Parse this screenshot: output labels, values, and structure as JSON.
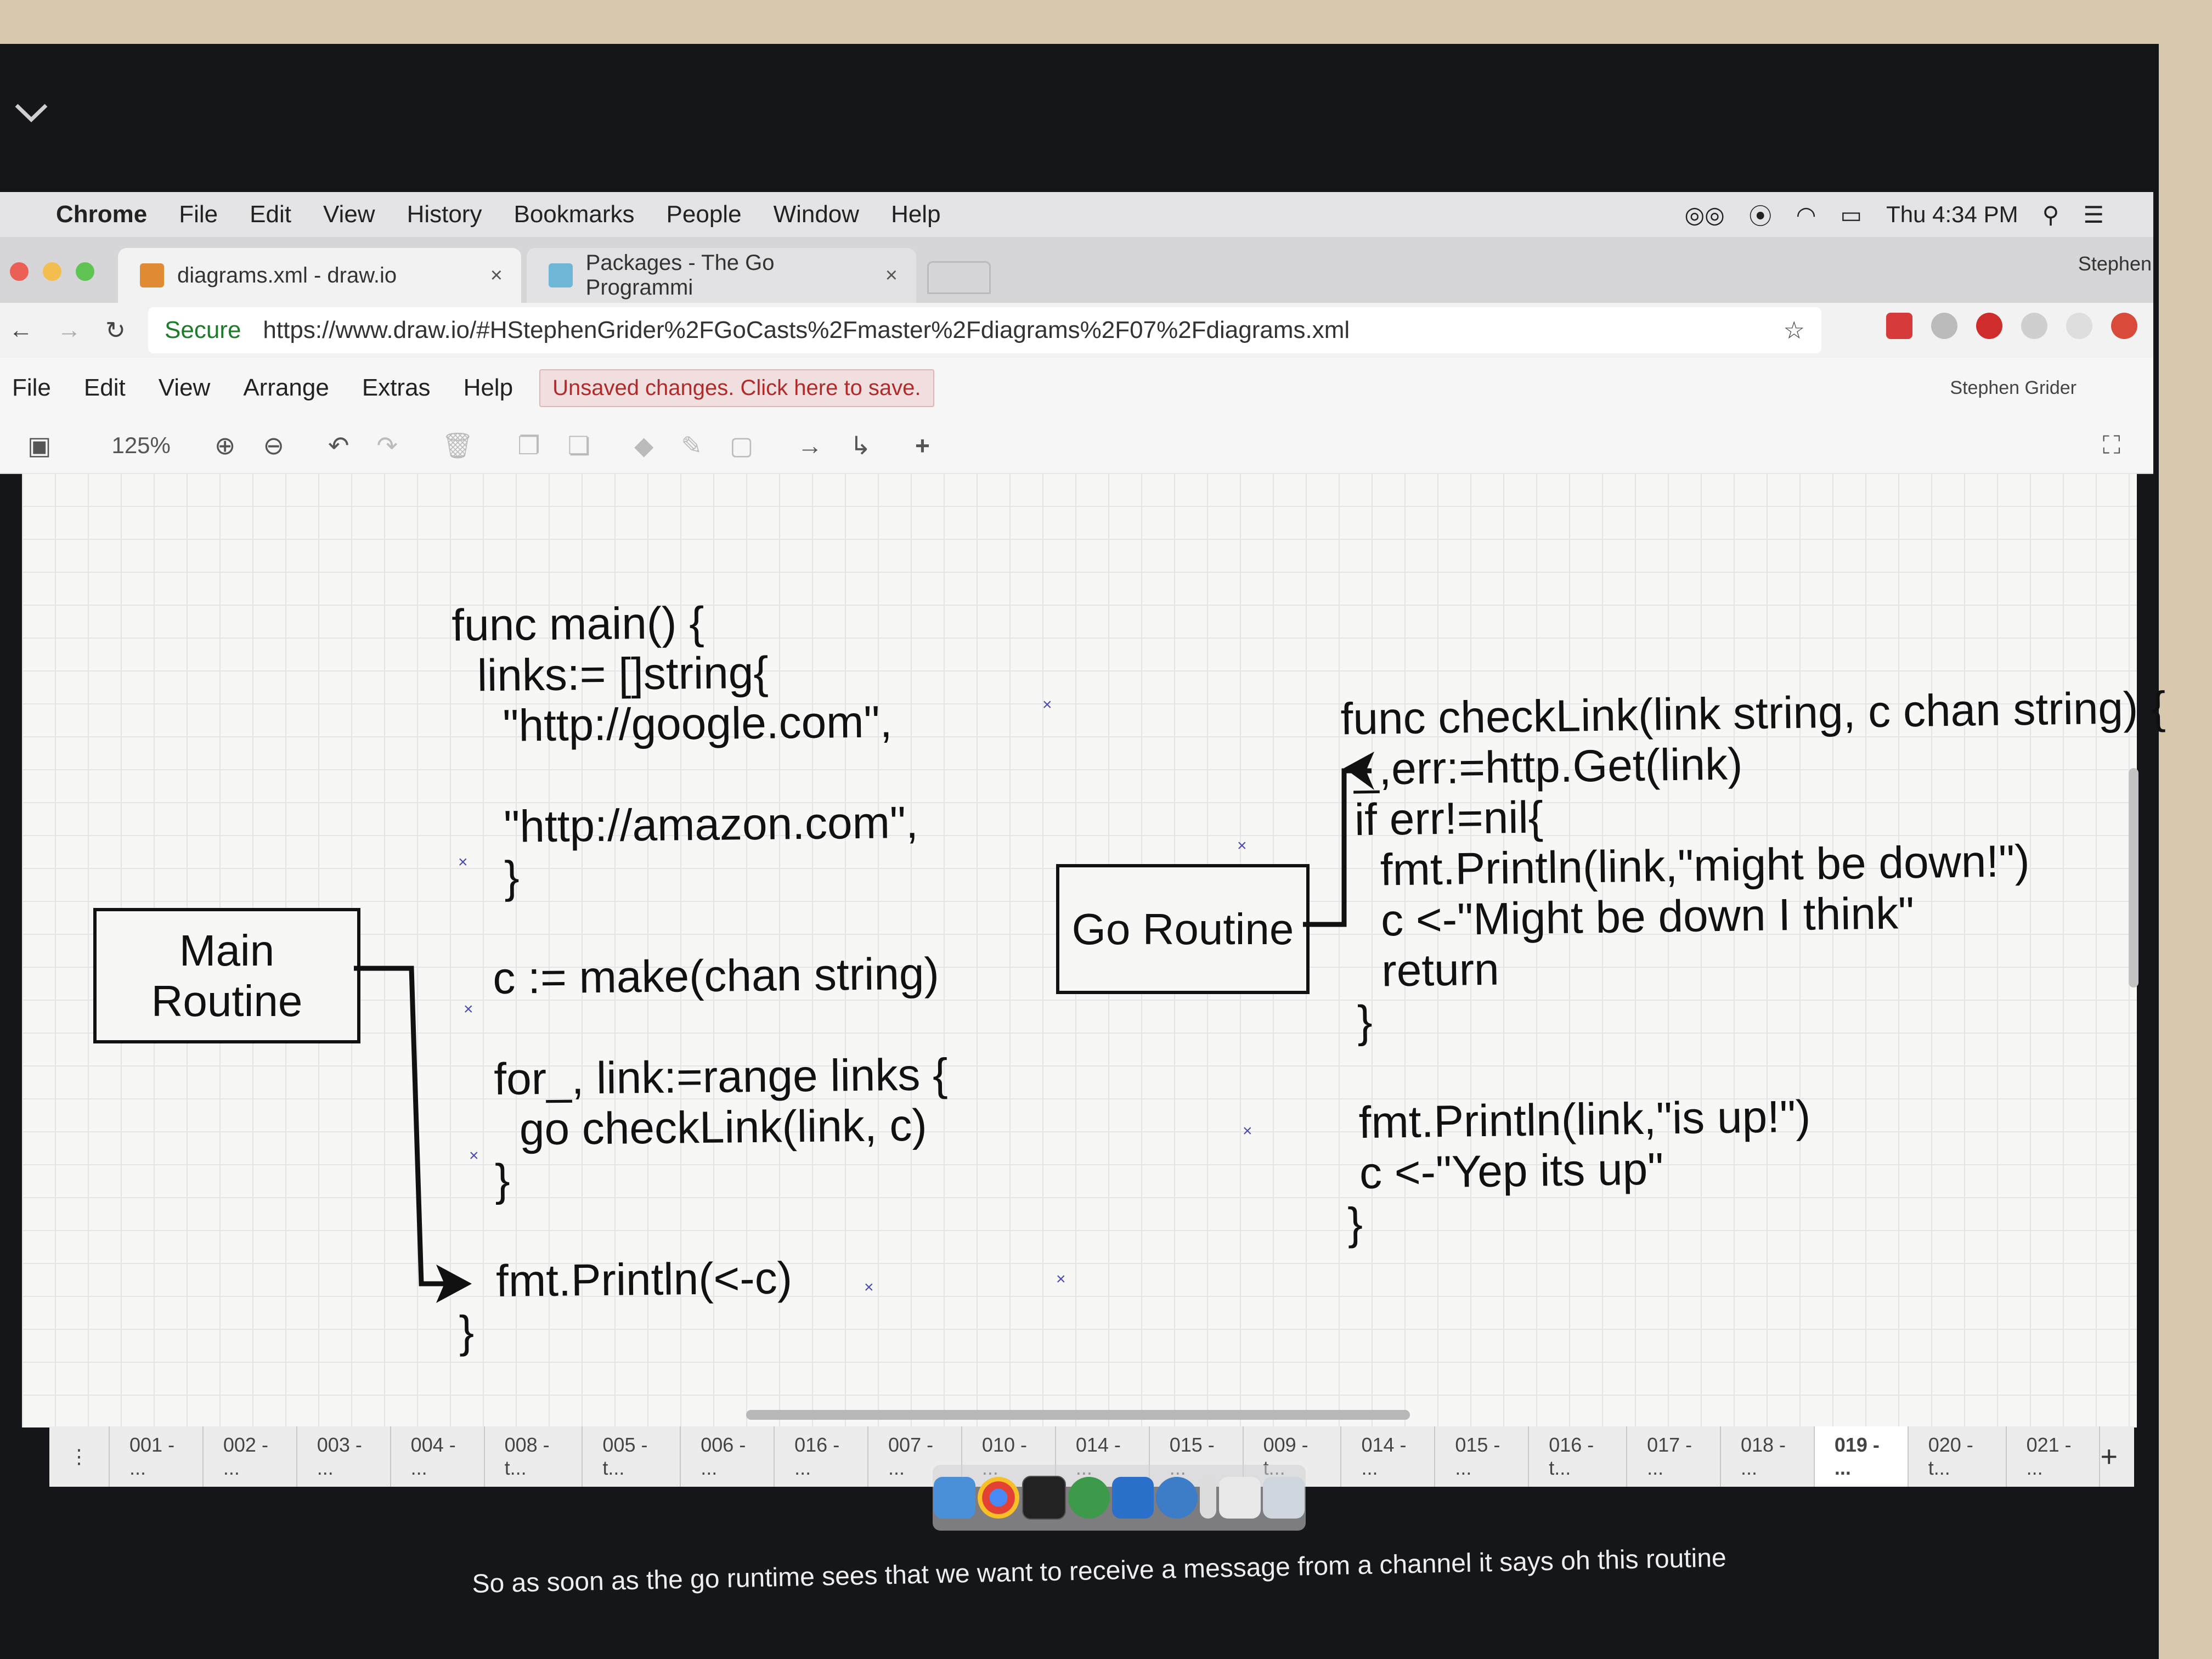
{
  "menubar": {
    "app": "Chrome",
    "items": [
      "File",
      "Edit",
      "View",
      "History",
      "Bookmarks",
      "People",
      "Window",
      "Help"
    ],
    "clock": "Thu 4:34 PM"
  },
  "browser": {
    "tabs": [
      {
        "title": "diagrams.xml - draw.io",
        "close": "×"
      },
      {
        "title": "Packages - The Go Programmi",
        "close": "×"
      }
    ],
    "profile": "Stephen",
    "secure_label": "Secure",
    "url": "https://www.draw.io/#HStephenGrider%2FGoCasts%2Fmaster%2Fdiagrams%2F07%2Fdiagrams.xml"
  },
  "drawio": {
    "menu": [
      "File",
      "Edit",
      "View",
      "Arrange",
      "Extras",
      "Help"
    ],
    "unsaved": "Unsaved changes. Click here to save.",
    "user": "Stephen Grider",
    "zoom": "125%"
  },
  "diagram": {
    "main_code": "func main() {\n  links:= []string{\n    \"http://google.com\",\n\n    \"http://amazon.com\",\n    }\n\n   c := make(chan string)\n\n   for_, link:=range links {\n     go checkLink(link, c)\n   }\n\n   fmt.Println(<-c)\n}",
    "check_code": "func checkLink(link string, c chan string) {\n _,err:=http.Get(link)\n if err!=nil{\n   fmt.Println(link,\"might be down!\")\n   c <-\"Might be down I think\"\n   return\n }\n\n fmt.Println(link,\"is up!\")\n c <-\"Yep its up\"\n}",
    "main_box": "Main\nRoutine",
    "go_box": "Go Routine"
  },
  "page_tabs": [
    "001 - ...",
    "002 - ...",
    "003 - ...",
    "004 - ...",
    "008 - t...",
    "005 - t...",
    "006 - ...",
    "016 - ...",
    "007 - ...",
    "010 - ...",
    "014 - ...",
    "015 - ...",
    "009 - t...",
    "014 - ...",
    "015 - ...",
    "016 - t...",
    "017 - ...",
    "018 - ...",
    "019 - ...",
    "020 - t...",
    "021 - ..."
  ],
  "active_page_index": 18,
  "caption": "So as soon as the go runtime sees that we want to receive a message from a channel it says oh this routine"
}
